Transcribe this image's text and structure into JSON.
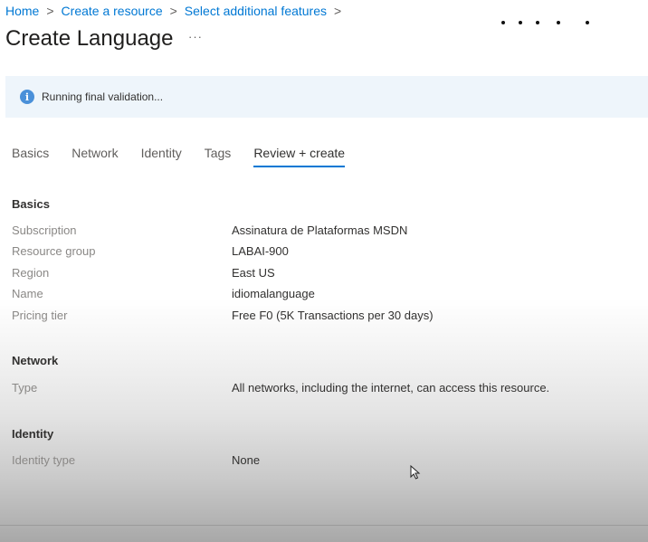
{
  "breadcrumb": {
    "items": [
      "Home",
      "Create a resource",
      "Select additional features"
    ],
    "separator": ">"
  },
  "header": {
    "title": "Create Language",
    "more": "···"
  },
  "banner": {
    "icon": "info-icon",
    "text": "Running final validation..."
  },
  "tabs": {
    "items": [
      "Basics",
      "Network",
      "Identity",
      "Tags",
      "Review + create"
    ],
    "active": "Review + create"
  },
  "review": {
    "basics": {
      "title": "Basics",
      "fields": [
        {
          "label": "Subscription",
          "value": "Assinatura de Plataformas MSDN"
        },
        {
          "label": "Resource group",
          "value": "LABAI-900"
        },
        {
          "label": "Region",
          "value": "East US"
        },
        {
          "label": "Name",
          "value": "idiomalanguage"
        },
        {
          "label": "Pricing tier",
          "value": "Free F0 (5K Transactions per 30 days)"
        }
      ]
    },
    "network": {
      "title": "Network",
      "fields": [
        {
          "label": "Type",
          "value": "All networks, including the internet, can access this resource."
        }
      ]
    },
    "identity": {
      "title": "Identity",
      "fields": [
        {
          "label": "Identity type",
          "value": "None"
        }
      ]
    }
  },
  "colors": {
    "accent": "#0078d4",
    "banner_bg": "#eef5fb",
    "info_icon": "#4a90d9"
  }
}
